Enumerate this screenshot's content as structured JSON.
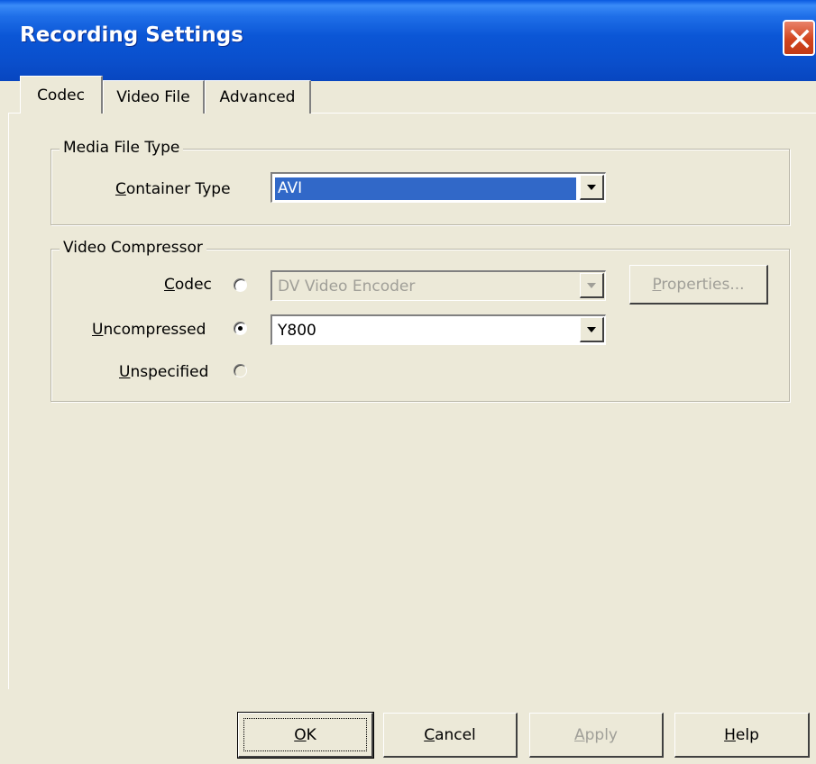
{
  "window": {
    "title": "Recording Settings"
  },
  "tabs": [
    {
      "label": "Codec",
      "active": true
    },
    {
      "label": "Video File",
      "active": false
    },
    {
      "label": "Advanced",
      "active": false
    }
  ],
  "media_file_type": {
    "legend": "Media File Type",
    "container_type_label_prefix": "",
    "container_type_label_mnemonic": "C",
    "container_type_label_rest": "ontainer Type",
    "container_type_value": "AVI"
  },
  "video_compressor": {
    "legend": "Video Compressor",
    "codec_mnemonic": "C",
    "codec_rest": "odec",
    "codec_selected": false,
    "codec_value": "DV Video Encoder",
    "properties_mnemonic": "P",
    "properties_rest": "roperties...",
    "uncompressed_mnemonic": "U",
    "uncompressed_rest": "ncompressed",
    "uncompressed_selected": true,
    "uncompressed_value": "Y800",
    "unspecified_mnemonic": "U",
    "unspecified_rest": "nspecified",
    "unspecified_selected": false
  },
  "buttons": {
    "ok_mnemonic": "O",
    "ok_rest": "K",
    "cancel_mnemonic": "C",
    "cancel_rest": "ancel",
    "apply_mnemonic": "A",
    "apply_rest": "pply",
    "help_mnemonic": "H",
    "help_rest": "elp"
  },
  "colors": {
    "titlebar": "#0a4fcc",
    "dialog_face": "#ece9d8",
    "selection": "#3168c8",
    "close_button": "#d2451e"
  },
  "icons": {
    "close": "close-x-icon",
    "dropdown": "chevron-down-icon"
  }
}
